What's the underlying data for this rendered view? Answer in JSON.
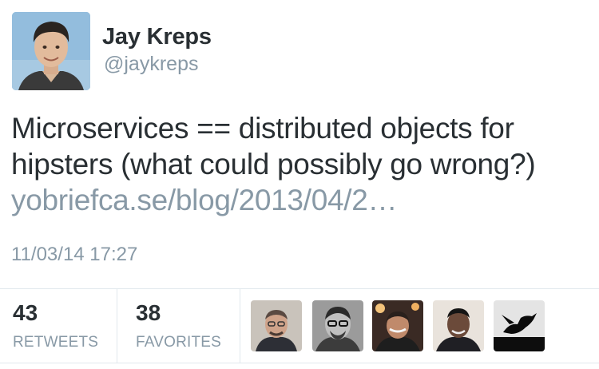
{
  "author": {
    "name": "Jay Kreps",
    "handle": "@jaykreps"
  },
  "tweet": {
    "line1": "Microservices == distributed objects for",
    "line2": "hipsters (what could possibly go wrong?)",
    "link": "yobriefca.se/blog/2013/04/2…"
  },
  "timestamp": "11/03/14 17:27",
  "stats": {
    "retweets": {
      "count": "43",
      "label": "RETWEETS"
    },
    "favorites": {
      "count": "38",
      "label": "FAVORITES"
    }
  },
  "favoriters": [
    "avatar",
    "avatar",
    "avatar",
    "avatar",
    "avatar"
  ],
  "colors": {
    "text": "#292f33",
    "muted": "#8899a6",
    "divider": "#e1e8ed"
  }
}
